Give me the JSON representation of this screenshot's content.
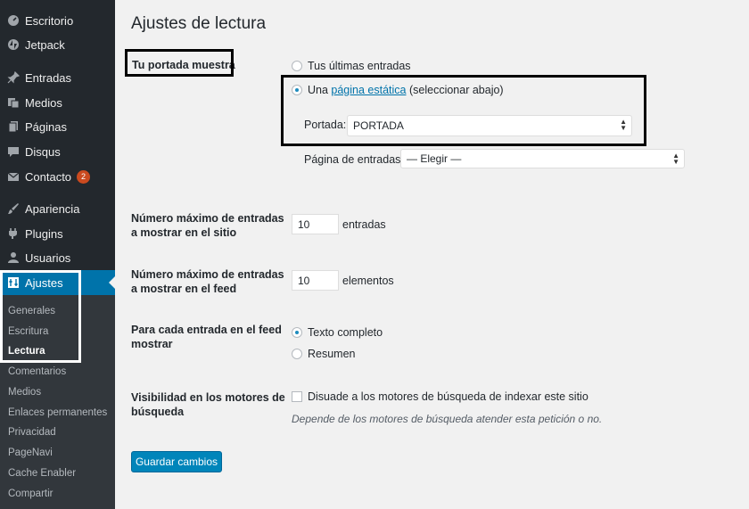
{
  "sidebar": {
    "items": [
      {
        "label": "Escritorio",
        "icon": "dashboard-icon"
      },
      {
        "label": "Jetpack",
        "icon": "jetpack-icon"
      },
      {
        "label": "Entradas",
        "icon": "pin-icon"
      },
      {
        "label": "Medios",
        "icon": "media-icon"
      },
      {
        "label": "Páginas",
        "icon": "pages-icon"
      },
      {
        "label": "Disqus",
        "icon": "comment-icon"
      },
      {
        "label": "Contacto",
        "icon": "mail-icon",
        "badge": "2"
      },
      {
        "label": "Apariencia",
        "icon": "brush-icon"
      },
      {
        "label": "Plugins",
        "icon": "plugin-icon"
      },
      {
        "label": "Usuarios",
        "icon": "user-icon"
      },
      {
        "label": "Ajustes",
        "icon": "settings-icon",
        "active": true
      }
    ],
    "submenu": [
      "Generales",
      "Escritura",
      "Lectura",
      "Comentarios",
      "Medios",
      "Enlaces permanentes",
      "Privacidad",
      "PageNavi",
      "Cache Enabler",
      "Compartir"
    ],
    "submenu_current": "Lectura"
  },
  "page": {
    "title": "Ajustes de lectura",
    "front": {
      "label": "Tu portada muestra",
      "opt_latest": "Tus últimas entradas",
      "opt_static_prefix": "Una ",
      "opt_static_link": "página estática",
      "opt_static_suffix": " (seleccionar abajo)",
      "selected": "static",
      "portada_label": "Portada:",
      "portada_value": "PORTADA",
      "posts_label": "Página de entradas:",
      "posts_value": "— Elegir —"
    },
    "posts_per_page": {
      "label1": "Número máximo de entradas",
      "label2": "a mostrar en el sitio",
      "value": "10",
      "unit": "entradas"
    },
    "posts_per_rss": {
      "label1": "Número máximo de entradas",
      "label2": "a mostrar en el feed",
      "value": "10",
      "unit": "elementos"
    },
    "feed": {
      "label1": "Para cada entrada en el feed",
      "label2": "mostrar",
      "opt_full": "Texto completo",
      "opt_summary": "Resumen",
      "selected": "full"
    },
    "visibility": {
      "label1": "Visibilidad en los motores de",
      "label2": "búsqueda",
      "checkbox_label": "Disuade a los motores de búsqueda de indexar este sitio",
      "checked": false,
      "desc": "Depende de los motores de búsqueda atender esta petición o no."
    },
    "save_label": "Guardar cambios"
  },
  "colors": {
    "sidebar_bg": "#23282d",
    "submenu_bg": "#32373c",
    "accent": "#0073aa",
    "button": "#0085ba",
    "badge": "#ca4a1f"
  }
}
